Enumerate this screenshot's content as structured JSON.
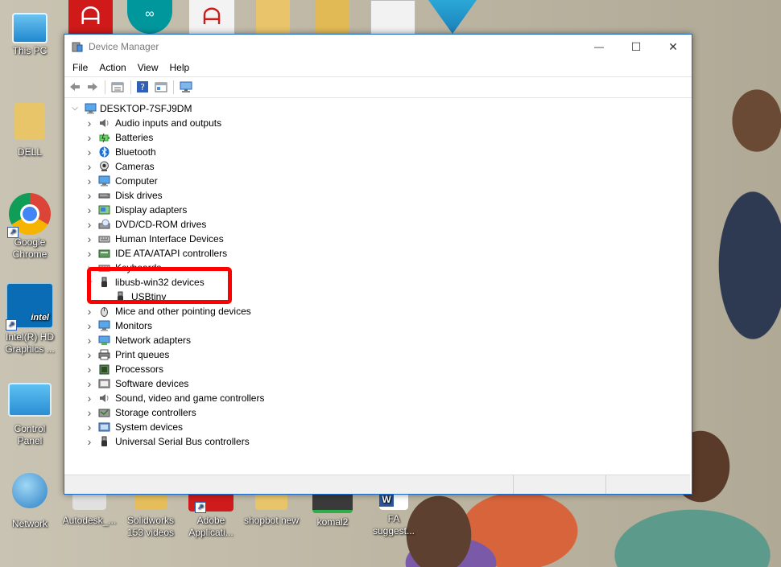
{
  "desktop": {
    "left_icons": [
      {
        "label": "This PC",
        "icon": "computer-icon"
      },
      {
        "label": "DELL",
        "icon": "user-folder-icon"
      },
      {
        "label": "Google Chrome",
        "icon": "chrome-icon"
      },
      {
        "label": "Intel(R) HD Graphics ...",
        "icon": "intel-graphics-icon"
      },
      {
        "label": "Control Panel",
        "icon": "control-panel-icon"
      },
      {
        "label": "Network",
        "icon": "network-icon"
      }
    ],
    "bottom_icons": [
      {
        "label": "Autodesk_...",
        "icon": "autodesk-icon"
      },
      {
        "label": "Solidworks 153 videos",
        "icon": "folder-icon"
      },
      {
        "label": "Adobe Applicati...",
        "icon": "adobe-icon"
      },
      {
        "label": "shopbot new",
        "icon": "folder-icon"
      },
      {
        "label": "komal2",
        "icon": "image-file-icon"
      },
      {
        "label": "FA suggest...",
        "icon": "word-document-icon"
      }
    ]
  },
  "window": {
    "title": "Device Manager",
    "controls": {
      "minimize": "—",
      "maximize": "☐",
      "close": "✕"
    },
    "menu": [
      "File",
      "Action",
      "View",
      "Help"
    ],
    "tree": {
      "root": "DESKTOP-7SFJ9DM",
      "items": [
        {
          "label": "Audio inputs and outputs",
          "icon": "speaker-icon"
        },
        {
          "label": "Batteries",
          "icon": "battery-icon"
        },
        {
          "label": "Bluetooth",
          "icon": "bluetooth-icon"
        },
        {
          "label": "Cameras",
          "icon": "camera-icon"
        },
        {
          "label": "Computer",
          "icon": "monitor-icon"
        },
        {
          "label": "Disk drives",
          "icon": "disk-drive-icon"
        },
        {
          "label": "Display adapters",
          "icon": "display-adapter-icon"
        },
        {
          "label": "DVD/CD-ROM drives",
          "icon": "dvd-drive-icon"
        },
        {
          "label": "Human Interface Devices",
          "icon": "keyboard-icon"
        },
        {
          "label": "IDE ATA/ATAPI controllers",
          "icon": "ide-controller-icon"
        },
        {
          "label": "Keyboards",
          "icon": "keyboard-icon"
        },
        {
          "label": "libusb-win32 devices",
          "icon": "usb-plug-icon",
          "expanded": true,
          "children": [
            {
              "label": "USBtiny",
              "icon": "usb-plug-icon"
            }
          ]
        },
        {
          "label": "Mice and other pointing devices",
          "icon": "mouse-icon"
        },
        {
          "label": "Monitors",
          "icon": "monitor-icon"
        },
        {
          "label": "Network adapters",
          "icon": "network-adapter-icon"
        },
        {
          "label": "Print queues",
          "icon": "printer-icon"
        },
        {
          "label": "Processors",
          "icon": "processor-icon"
        },
        {
          "label": "Software devices",
          "icon": "software-device-icon"
        },
        {
          "label": "Sound, video and game controllers",
          "icon": "speaker-icon"
        },
        {
          "label": "Storage controllers",
          "icon": "storage-controller-icon"
        },
        {
          "label": "System devices",
          "icon": "system-device-icon"
        },
        {
          "label": "Universal Serial Bus controllers",
          "icon": "usb-plug-icon"
        }
      ]
    }
  },
  "colors": {
    "window_border": "#1a6cc7",
    "highlight": "#ff0000",
    "title_text": "#7a7a7a"
  }
}
